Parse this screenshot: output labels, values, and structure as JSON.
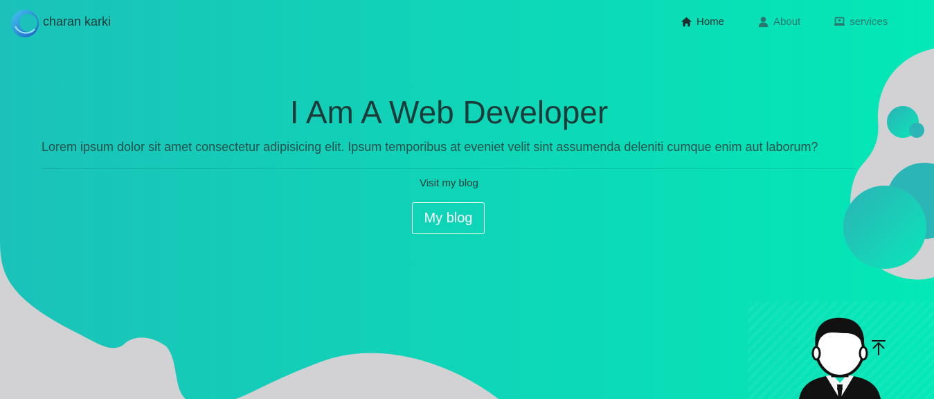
{
  "brand": {
    "name": "charan karki",
    "logo_icon": "c-logo-icon"
  },
  "nav": {
    "items": [
      {
        "label": "Home",
        "icon": "home-icon",
        "active": true
      },
      {
        "label": "About",
        "icon": "user-icon",
        "active": false
      },
      {
        "label": "services",
        "icon": "laptop-icon",
        "active": false
      }
    ]
  },
  "hero": {
    "title": "I Am A Web Developer",
    "text": "Lorem ipsum dolor sit amet consectetur adipisicing elit. Ipsum temporibus at eveniet velit sint assumenda deleniti cumque enim aut laborum?",
    "visit_label": "Visit my blog",
    "button_label": "My blog"
  },
  "colors": {
    "gradient_start": "#1bc2b9",
    "gradient_end": "#03e8b6",
    "blob_gray": "#d2d1d4",
    "text_dark": "#1d3b39"
  },
  "icons": {
    "scroll_top": "arrow-to-top-icon",
    "avatar": "person-avatar-icon"
  }
}
